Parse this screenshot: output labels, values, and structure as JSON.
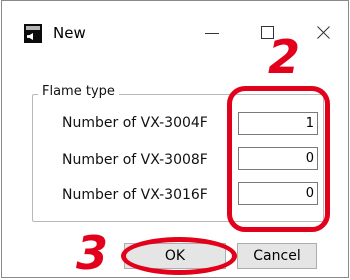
{
  "window": {
    "title": "New",
    "icon": "speaker-app-icon"
  },
  "group": {
    "legend": "Flame type",
    "rows": [
      {
        "label": "Number of VX-3004F",
        "value": "1"
      },
      {
        "label": "Number of VX-3008F",
        "value": "0"
      },
      {
        "label": "Number of VX-3016F",
        "value": "0"
      }
    ]
  },
  "buttons": {
    "ok": "OK",
    "cancel": "Cancel"
  },
  "annotations": {
    "step_fields": "2",
    "step_ok": "3",
    "color": "#e2001a"
  }
}
